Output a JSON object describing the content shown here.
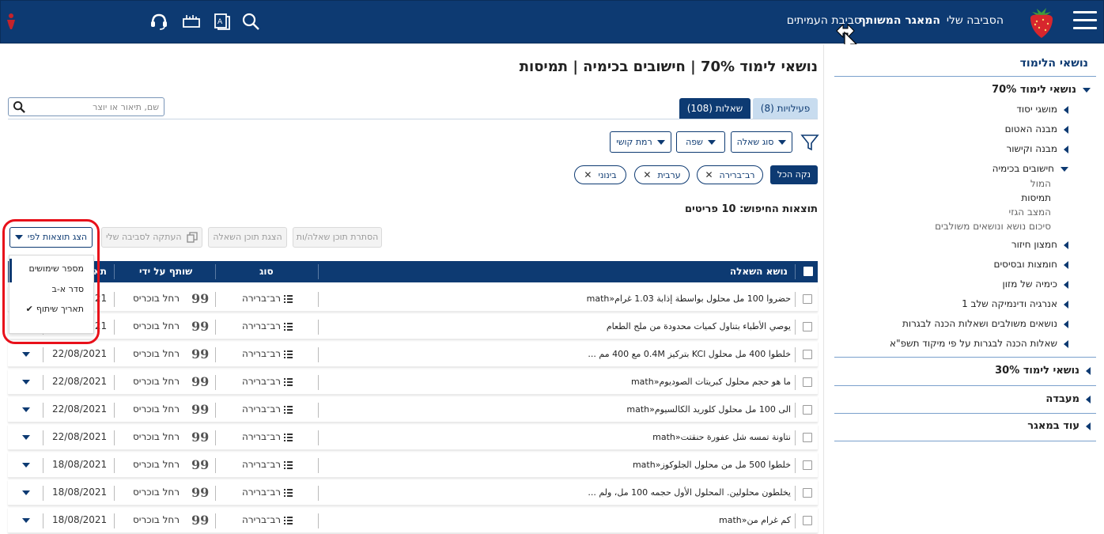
{
  "topbar": {
    "nav": [
      "הסביבה שלי",
      "המאגר המשותף",
      "סביבת העמיתים"
    ],
    "colors": {
      "bar": "#0d3a72",
      "highlight": "#e8101a"
    }
  },
  "sidebar": {
    "title": "נושאי הלימוד",
    "items": [
      {
        "label": "נושאי לימוד 70%"
      },
      {
        "label": "מושגי יסוד"
      },
      {
        "label": "מבנה האטום"
      },
      {
        "label": "מבנה וקישור"
      },
      {
        "label": "חישובים בכימיה"
      },
      {
        "label": "המול"
      },
      {
        "label": "תמיסות"
      },
      {
        "label": "המצב הגזי"
      },
      {
        "label": "סיכום נושא ונושאים משולבים"
      },
      {
        "label": "חמצון חיזור"
      },
      {
        "label": "חומצות ובסיסים"
      },
      {
        "label": "כימיה של מזון"
      },
      {
        "label": "אנרגיה ודינמיקה שלב 1"
      },
      {
        "label": "נושאים משולבים ושאלות הכנה לבגרות"
      },
      {
        "label": "שאלות הכנה לבגרות על פי מיקוד תשפ\"א"
      },
      {
        "label": "נושאי לימוד 30%"
      },
      {
        "label": "מעבדה"
      },
      {
        "label": "עוד במאגר"
      }
    ]
  },
  "main": {
    "title": "נושאי לימוד 70% | חישובים בכימיה | תמיסות",
    "search": {
      "placeholder": "שם, תיאור או יוצר"
    },
    "tabs": [
      {
        "label": "שאלות (108)"
      },
      {
        "label": "פעילויות (8)"
      }
    ],
    "filters": [
      {
        "label": "סוג שאלה"
      },
      {
        "label": "שפה"
      },
      {
        "label": "רמת קושי"
      }
    ],
    "chips": [
      {
        "label": "רב־ברירה"
      },
      {
        "label": "ערבית"
      },
      {
        "label": "בינוני"
      }
    ],
    "clear_all": "נקה הכל",
    "results": "תוצאות החיפוש: 10 פריטים",
    "actions": {
      "hide": "הסתרת תוכן שאלה/ות",
      "show": "הצגת תוכן השאלה",
      "copy": "העתקה לסביבה שלי",
      "sort": "הצג תוצאות לפי"
    },
    "sort_menu": {
      "items": [
        "מספר שימושים",
        "סדר א-ב",
        "תאריך שיתוף"
      ],
      "checkmark": "✔"
    },
    "table": {
      "headers": [
        "נושא השאלה",
        "סוג",
        "שותף על ידי",
        "תא"
      ],
      "rows": [
        {
          "question": "حضروا 100 مل محلول بواسطة إذابة 1.03 غرام«math",
          "type": "רב־ברירה",
          "sharer": "רחל בוכריס",
          "date": "22/08/2021"
        },
        {
          "question": "يوصي الأطباء بتناول كميات محدودة من ملح الطعام",
          "type": "רב־ברירה",
          "sharer": "רחל בוכריס",
          "date": "22/08/2021"
        },
        {
          "question": "خلطوا 400 مل محلول KCl بتركيز 0.4M مع 400 مم ...",
          "type": "רב־ברירה",
          "sharer": "רחל בוכריס",
          "date": "22/08/2021"
        },
        {
          "question": "ما هو حجم محلول كبريتات الصوديوم«math",
          "type": "רב־ברירה",
          "sharer": "רחל בוכריס",
          "date": "22/08/2021"
        },
        {
          "question": "الى 100 مل محلول كلوريد الكالسيوم«math",
          "type": "רב־ברירה",
          "sharer": "רחל בוכריס",
          "date": "22/08/2021"
        },
        {
          "question": "نتاونة تمسه شل عفورة حنقتت«math",
          "type": "רב־ברירה",
          "sharer": "רחל בוכריס",
          "date": "22/08/2021"
        },
        {
          "question": "خلطوا 500 مل من محلول الجلوكوز«math",
          "type": "רב־ברירה",
          "sharer": "רחל בוכריס",
          "date": "18/08/2021"
        },
        {
          "question": "يخلطون محلولين. المحلول الأول حجمه 100 مل، ولم ...",
          "type": "רב־ברירה",
          "sharer": "רחל בוכריס",
          "date": "18/08/2021"
        },
        {
          "question": "كم غرام من«math",
          "type": "רב־ברירה",
          "sharer": "רחל בוכריס",
          "date": "18/08/2021"
        }
      ]
    }
  }
}
